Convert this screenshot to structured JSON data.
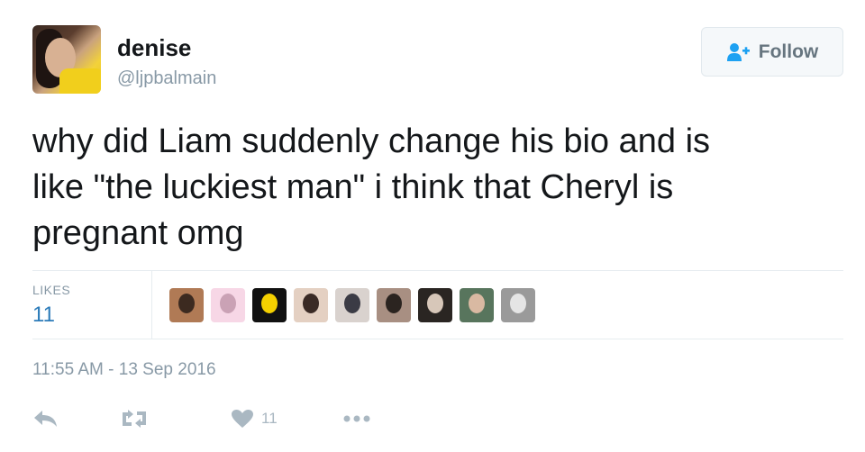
{
  "user": {
    "display_name": "denise",
    "handle": "@ljpbalmain"
  },
  "follow_button": {
    "label": "Follow",
    "icon": "add-user-icon"
  },
  "tweet": {
    "text": "why did Liam suddenly change his bio and is\nlike \"the luckiest man\" i think that Cheryl is\npregnant omg",
    "timestamp": "11:55 AM - 13 Sep 2016"
  },
  "stats": {
    "likes_label": "LIKES",
    "likes_count": "11"
  },
  "likers": [
    {
      "colors": [
        "#b07a55",
        "#3c2a20"
      ]
    },
    {
      "colors": [
        "#f7d7e6",
        "#caa2b5"
      ]
    },
    {
      "colors": [
        "#111111",
        "#f4d000"
      ]
    },
    {
      "colors": [
        "#e4d0c2",
        "#3a2a25"
      ]
    },
    {
      "colors": [
        "#d9d2ce",
        "#3b3b45"
      ]
    },
    {
      "colors": [
        "#a88f82",
        "#2b2420"
      ]
    },
    {
      "colors": [
        "#2a2522",
        "#d7c7b9"
      ]
    },
    {
      "colors": [
        "#58755d",
        "#d9b9a2"
      ]
    },
    {
      "colors": [
        "#9a9a9a",
        "#e5e5e5"
      ]
    }
  ],
  "actions": {
    "reply_icon": "reply-icon",
    "retweet_icon": "retweet-icon",
    "like_icon": "heart-icon",
    "like_count": "11",
    "more_icon": "more-icon"
  },
  "colors": {
    "text": "#14171a",
    "muted": "#8899a6",
    "link": "#2b7bb9",
    "action_icon": "#aab8c2",
    "follow_bg": "#f5f8fa"
  }
}
